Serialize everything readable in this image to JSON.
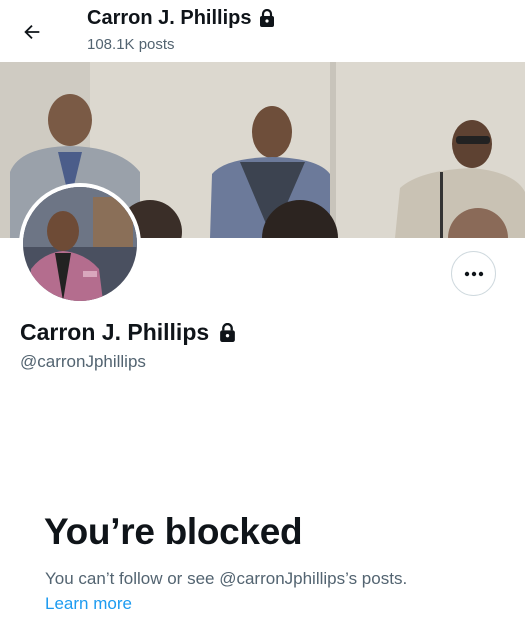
{
  "header": {
    "title": "Carron J. Phillips",
    "post_count": "108.1K posts",
    "back_icon": "arrow-left-icon",
    "lock_icon": "lock-icon"
  },
  "profile": {
    "name": "Carron J. Phillips",
    "handle": "@carronJphillips",
    "more_icon": "more-horizontal-icon"
  },
  "blocked": {
    "title": "You’re blocked",
    "description": "You can’t follow or see @carronJphillips’s posts.",
    "learn_more": "Learn more"
  },
  "colors": {
    "text_primary": "#0f1419",
    "text_secondary": "#536471",
    "link": "#1d9bf0",
    "border": "#cfd9de"
  }
}
